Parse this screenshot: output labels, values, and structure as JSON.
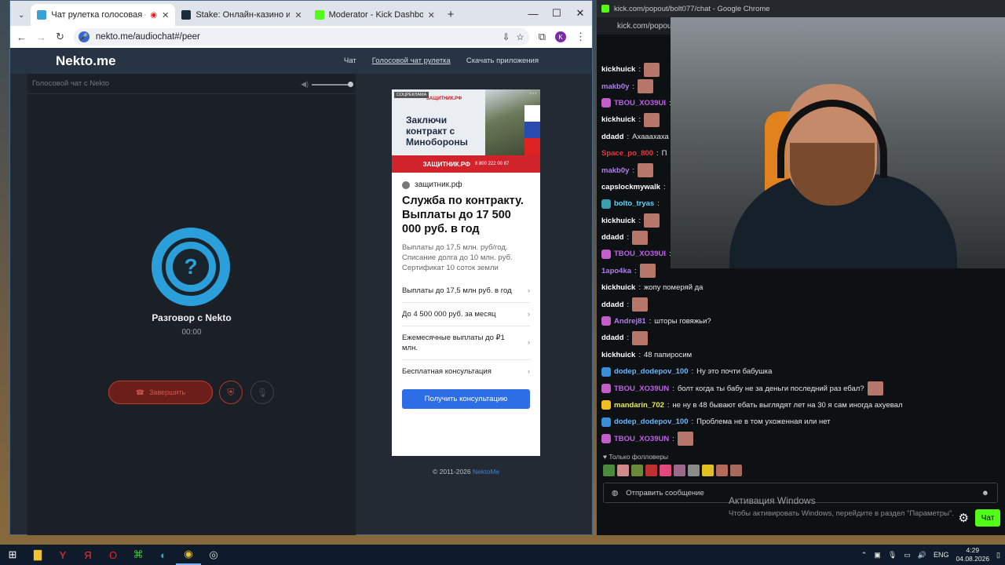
{
  "browser": {
    "tabs": [
      {
        "label": "Чат рулетка голосовая — Ne",
        "active": true
      },
      {
        "label": "Stake: Онлайн-казино и ставк",
        "active": false
      },
      {
        "label": "Moderator - Kick Dashboard",
        "active": false
      }
    ],
    "url": "nekto.me/audiochat#/peer",
    "profile_initial": "K"
  },
  "site": {
    "logo": "Nekto.me",
    "nav": [
      "Чат",
      "Голосовой чат рулетка",
      "Скачать приложения"
    ],
    "panel_title": "Голосовой чат с Nekto",
    "question_mark": "?",
    "conversation_title": "Разговор с Nekto",
    "timer": "00:00",
    "end_button": "Завершить",
    "copyright": "© 2011-2026 ",
    "copyright_link": "NektoMe"
  },
  "ad": {
    "badge": "СОЦРЕКЛАМА",
    "brand": "ЗАЩИТНИК.РФ",
    "banner_headline": "Заключи контракт с Минобороны",
    "strip_brand": "ЗАЩИТНИК.РФ",
    "strip_phone": "8 800 222 00 87",
    "site": "защитник.рф",
    "headline": "Служба по контракту. Выплаты до 17 500 000 руб. в год",
    "text": "Выплаты до 17,5 млн. руб/год. Списание долга до 10 млн. руб. Сертификат 10 соток земли",
    "links": [
      "Выплаты до 17,5 млн руб. в год",
      "До 4 500 000 руб. за месяц",
      "Ежемесячные выплаты до ₽1 млн.",
      "Бесплатная консультация"
    ],
    "cta": "Получить консультацию"
  },
  "kick": {
    "window_title": "kick.com/popout/bolt077/chat - Google Chrome",
    "url": "kick.com/popou",
    "messages_top": [
      {
        "user": "kickhuick",
        "color": "#ffffff",
        "text": "",
        "emote": true
      },
      {
        "user": "makb0y",
        "color": "#b07cf0",
        "text": "",
        "emote": true
      },
      {
        "user": "TBOU_XO39UI",
        "color": "#c060e8",
        "text": "",
        "emote": false,
        "badge": "#c45ec8"
      },
      {
        "user": "kickhuick",
        "color": "#ffffff",
        "text": "",
        "emote": true
      },
      {
        "user": "ddadd",
        "color": "#ffffff",
        "text": "Ахааахаха",
        "emote": false
      },
      {
        "user": "Space_po_800",
        "color": "#e8383d",
        "text": "П",
        "emote": false
      },
      {
        "user": "makb0y",
        "color": "#b07cf0",
        "text": "",
        "emote": true
      },
      {
        "user": "capslockmywalk",
        "color": "#ffffff",
        "text": "",
        "emote": false
      },
      {
        "user": "bolto_tryas",
        "color": "#5ad7ff",
        "text": "",
        "emote": false,
        "badge": "#3aa0b0"
      },
      {
        "user": "kickhuick",
        "color": "#ffffff",
        "text": "",
        "emote": true
      },
      {
        "user": "ddadd",
        "color": "#ffffff",
        "text": "",
        "emote": true
      },
      {
        "user": "TBOU_XO39UI",
        "color": "#c060e8",
        "text": "",
        "emote": false,
        "badge": "#c45ec8"
      },
      {
        "user": "1apo4ka",
        "color": "#b07cf0",
        "text": "",
        "emote": true
      }
    ],
    "messages_bottom": [
      {
        "user": "kickhuick",
        "color": "#ffffff",
        "text": "жопу померяй да",
        "emote": false
      },
      {
        "user": "ddadd",
        "color": "#ffffff",
        "text": "",
        "emote": true
      },
      {
        "user": "Andrej81",
        "color": "#b07cf0",
        "text": "шторы говяжьи?",
        "emote": false,
        "badge": "#c45ec8"
      },
      {
        "user": "ddadd",
        "color": "#ffffff",
        "text": "",
        "emote": true
      },
      {
        "user": "kickhuick",
        "color": "#ffffff",
        "text": "48 папиросим",
        "emote": false
      },
      {
        "user": "dodep_dodepov_100",
        "color": "#6cb6ff",
        "text": "Ну это почти бабушка",
        "emote": false,
        "badge": "#3b8fd8"
      },
      {
        "user": "TBOU_XO39UN",
        "color": "#c060e8",
        "text": "болт когда ты бабу не за деньги последний раз ебал?",
        "emote": true,
        "badge": "#c45ec8"
      },
      {
        "user": "mandarin_702",
        "color": "#e9e95a",
        "text": "не ну в 48 бывают ебать выглядят лет на 30 я сам иногда ахуевал",
        "emote": false,
        "badge": "#f0c020"
      },
      {
        "user": "dodep_dodepov_100",
        "color": "#6cb6ff",
        "text": "Проблема не в том ухоженная или нет",
        "emote": false,
        "badge": "#3b8fd8"
      },
      {
        "user": "TBOU_XO39UN",
        "color": "#c060e8",
        "text": "",
        "emote": true,
        "badge": "#c45ec8"
      }
    ],
    "followers_only": "Только фолловеры",
    "input_placeholder": "Отправить сообщение",
    "chat_button": "Чат",
    "activation_title": "Активация Windows",
    "activation_text": "Чтобы активировать Windows, перейдите в раздел \"Параметры\"."
  },
  "taskbar": {
    "lang": "ENG",
    "time": "4:29",
    "date": "04.08.2026"
  },
  "colors": {
    "kick_green": "#53fc18",
    "nekto_blue": "#2b9fda",
    "end_red": "#c23a2f"
  }
}
